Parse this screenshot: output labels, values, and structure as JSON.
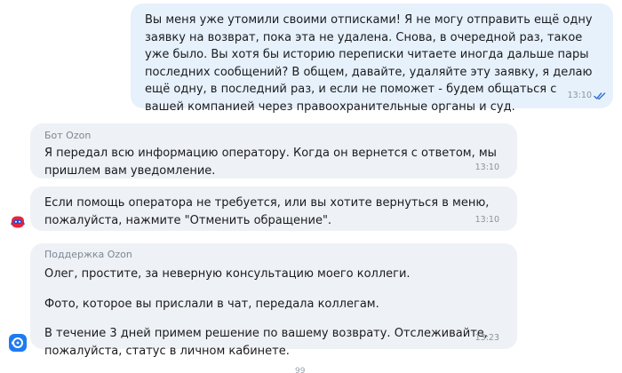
{
  "messages": {
    "user": {
      "text": "Вы меня уже утомили своими отписками! Я не могу отправить ещё одну заявку на возврат, пока эта не удалена. Снова, в очередной раз, такое уже было. Вы хотя бы историю переписки читаете иногда дальше пары последних сообщений? В общем, давайте, удаляйте эту заявку, я делаю ещё одну, в последний раз, и если не поможет - будем общаться с вашей компанией через правоохранительные органы и суд.",
      "time": "13:10",
      "status_icon": "double-check-icon"
    },
    "bot_1": {
      "sender": "Бот Ozon",
      "text": "Я передал всю информацию оператору. Когда он вернется с ответом, мы пришлем вам уведомление.",
      "time": "13:10"
    },
    "bot_2": {
      "text": "Если помощь оператора не требуется, или вы хотите вернуться в меню, пожалуйста, нажмите \"Отменить обращение\".",
      "time": "13:10"
    },
    "support": {
      "sender": "Поддержка Ozon",
      "paragraphs": [
        "Олег, простите, за неверную консультацию моего коллеги.",
        "Фото, которое вы прислали в чат, передала коллегам.",
        "В течение 3 дней примем решение по вашему возврату. Отслеживайте, пожалуйста, статус в личном кабинете."
      ],
      "time": "13:23"
    }
  },
  "avatars": {
    "bot": "ozon-bot-avatar-icon",
    "support": "ozon-support-avatar-icon"
  },
  "scroll_badge": "99",
  "colors": {
    "outgoing_bubble": "#e6f1fb",
    "incoming_bubble": "#eef1f5",
    "read_check": "#2f6fd6",
    "sender_name": "#7d8794"
  }
}
